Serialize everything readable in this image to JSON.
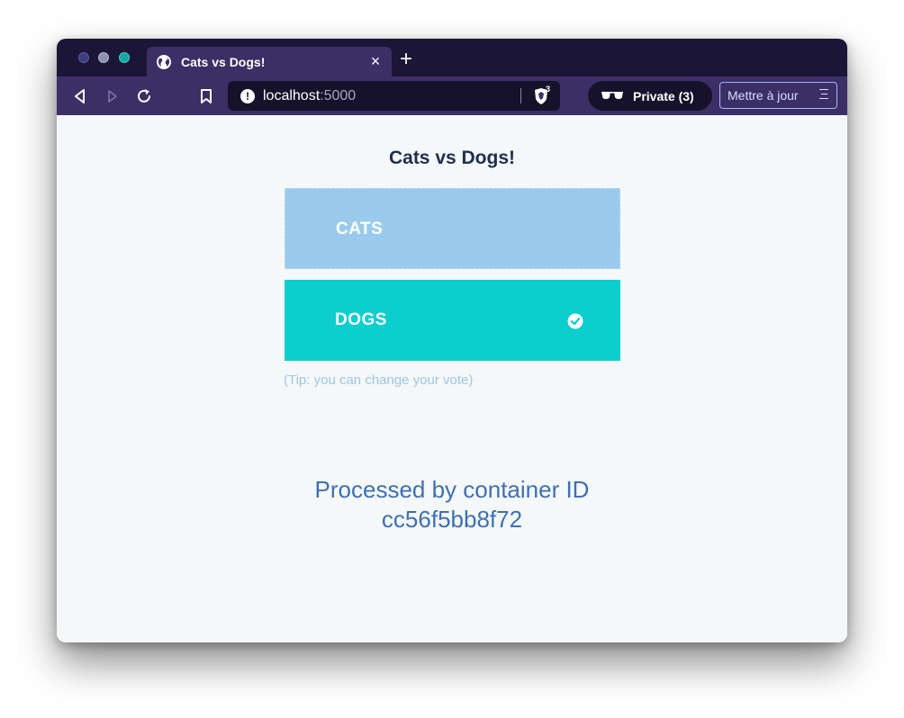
{
  "browser": {
    "tab": {
      "title": "Cats vs Dogs!",
      "close_glyph": "×",
      "icon": "globe-icon"
    },
    "new_tab_glyph": "+",
    "url": {
      "host": "localhost",
      "port": ":5000"
    },
    "shields_count": "3",
    "private": {
      "label": "Private (3)"
    },
    "update_button": {
      "label": "Mettre à jour"
    }
  },
  "page": {
    "title": "Cats vs Dogs!",
    "options": [
      {
        "label": "CATS",
        "selected": false,
        "color": "#9bcbec"
      },
      {
        "label": "DOGS",
        "selected": true,
        "color": "#0bcecd"
      }
    ],
    "tip": "(Tip: you can change your vote)",
    "processed_line1": "Processed by container ID",
    "processed_line2": "cc56f5bb8f72"
  },
  "colors": {
    "tabstrip": "#1b1636",
    "toolbar": "#3b2f66",
    "page_background": "#f4f8f9",
    "title": "#1f2d4f",
    "processed_text": "#3f6fb4"
  }
}
